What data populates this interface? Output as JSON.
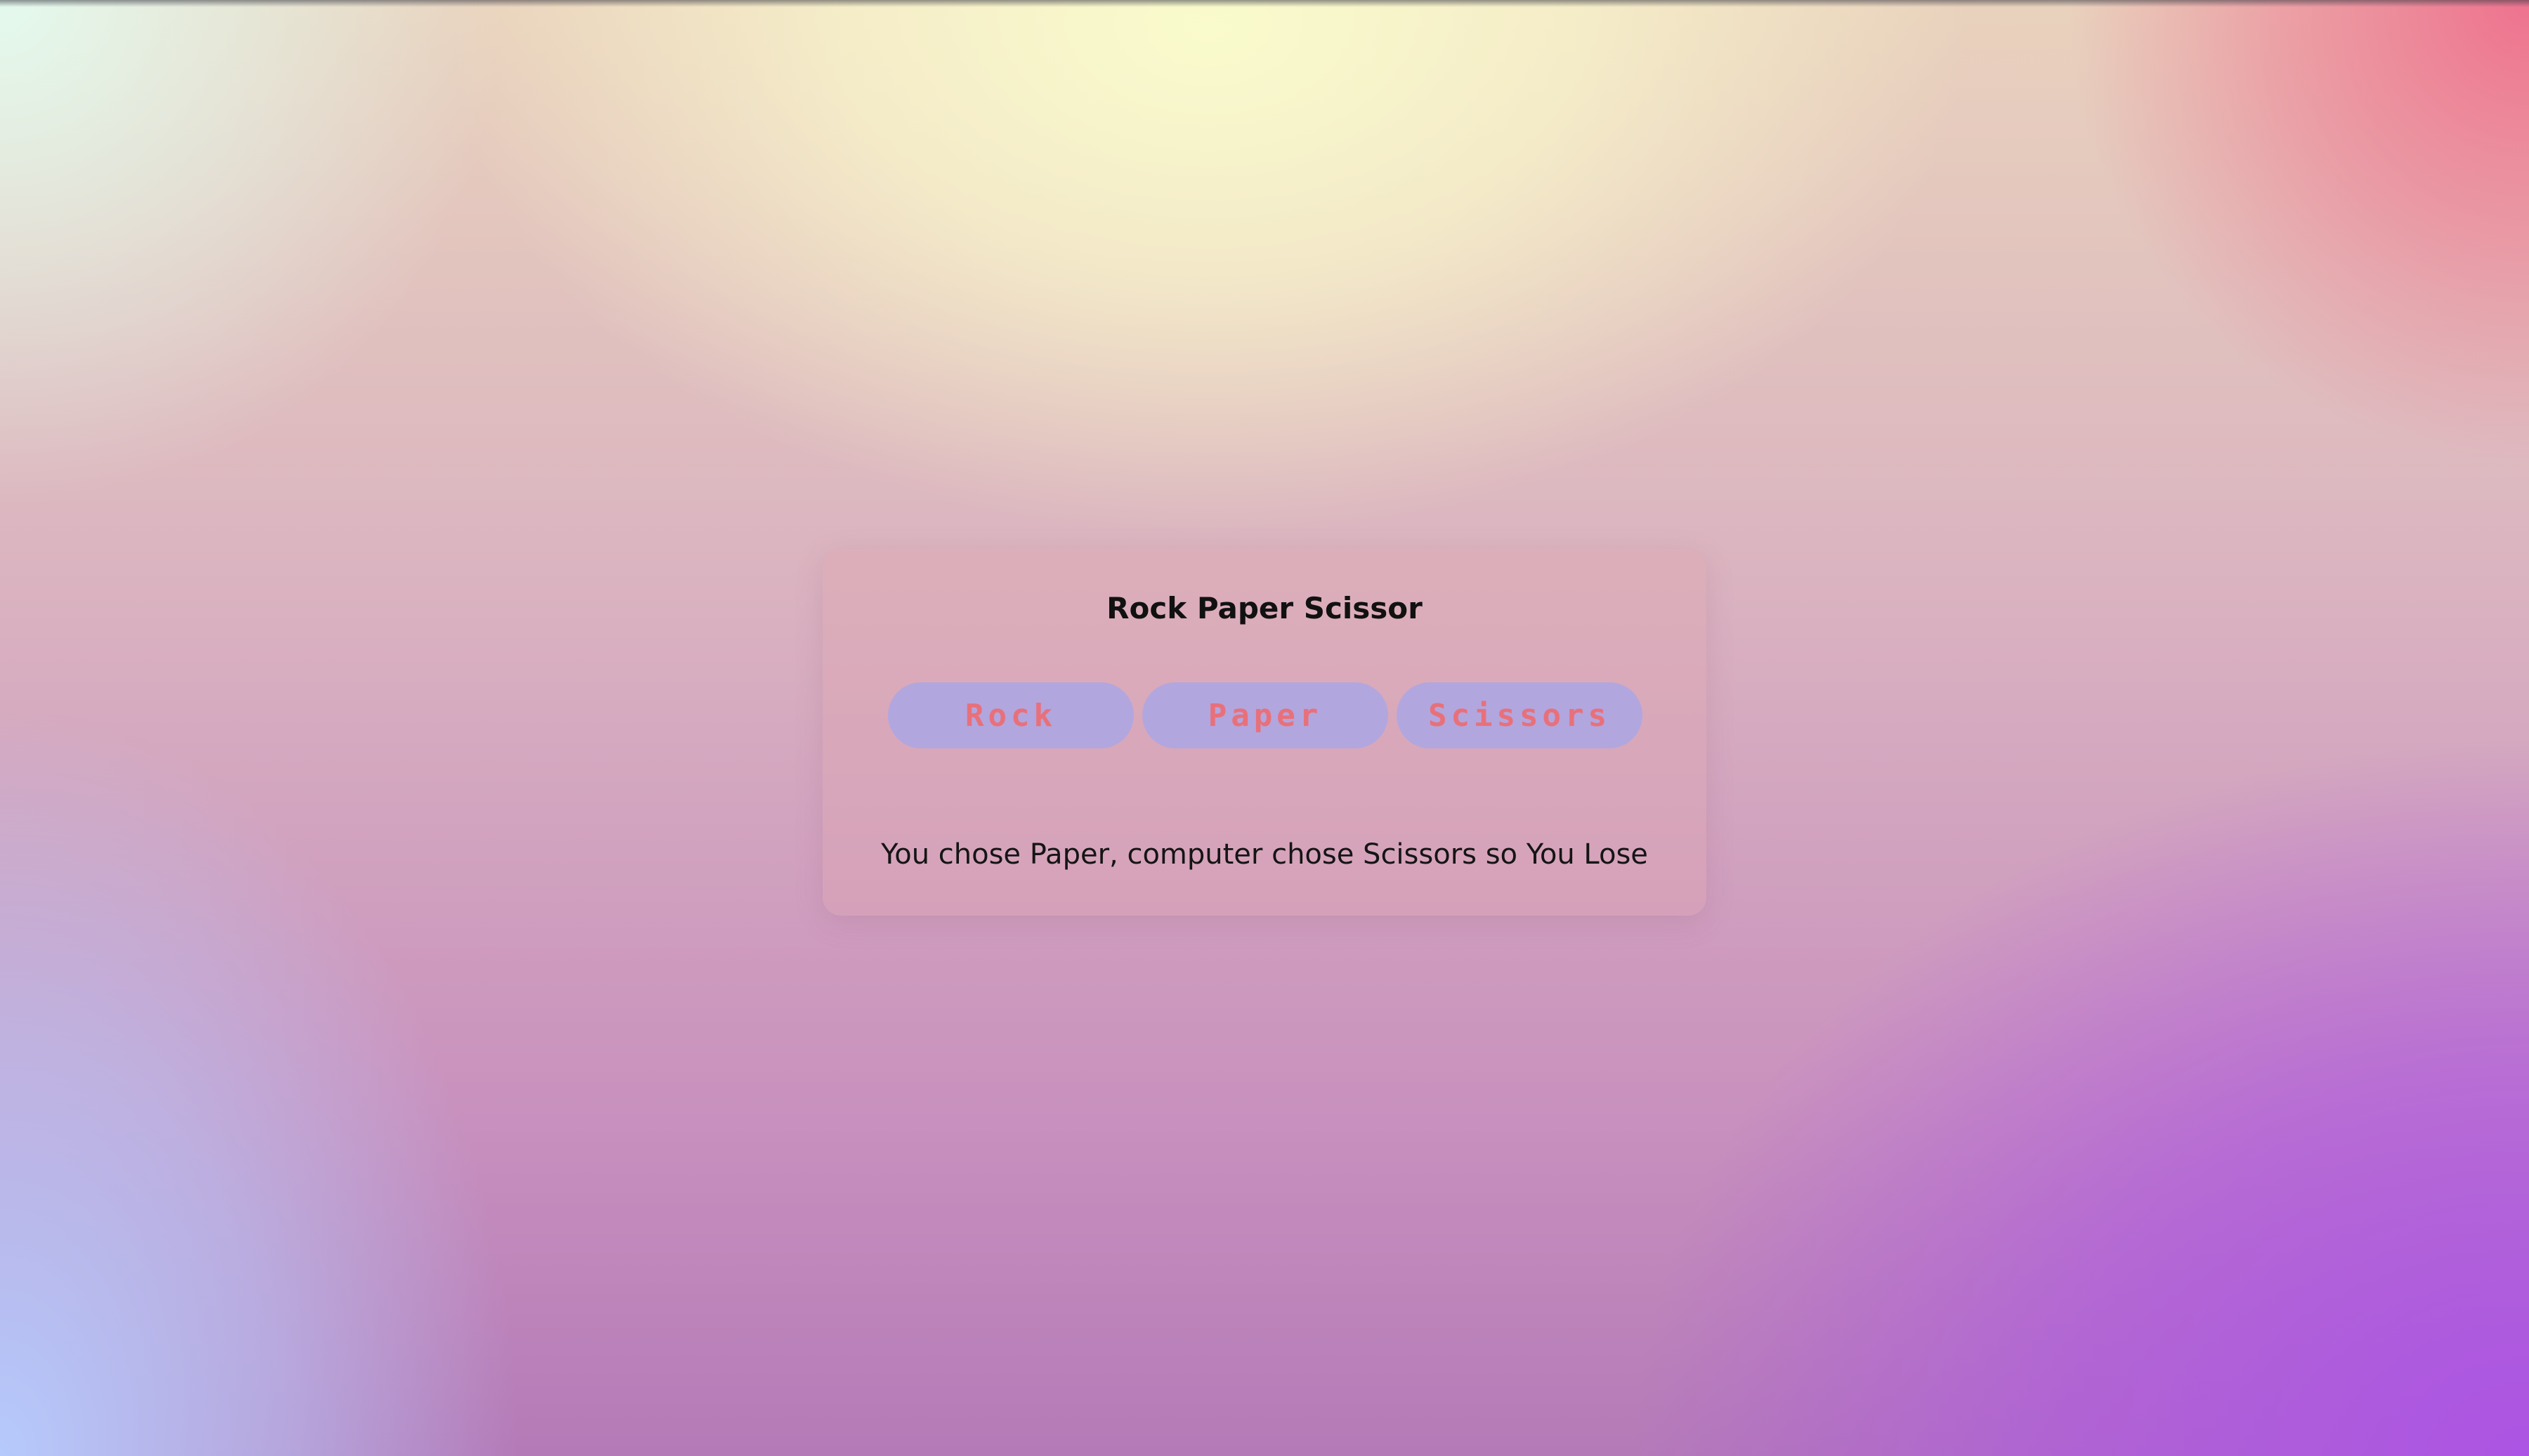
{
  "game": {
    "title": "Rock Paper Scissor",
    "buttons": [
      {
        "label": "Rock"
      },
      {
        "label": "Paper"
      },
      {
        "label": "Scissors"
      }
    ],
    "result": "You chose Paper, computer chose Scissors so You Lose"
  },
  "colors": {
    "button_bg": "#b2a6df",
    "button_text": "#e8707a",
    "text": "#111111"
  }
}
